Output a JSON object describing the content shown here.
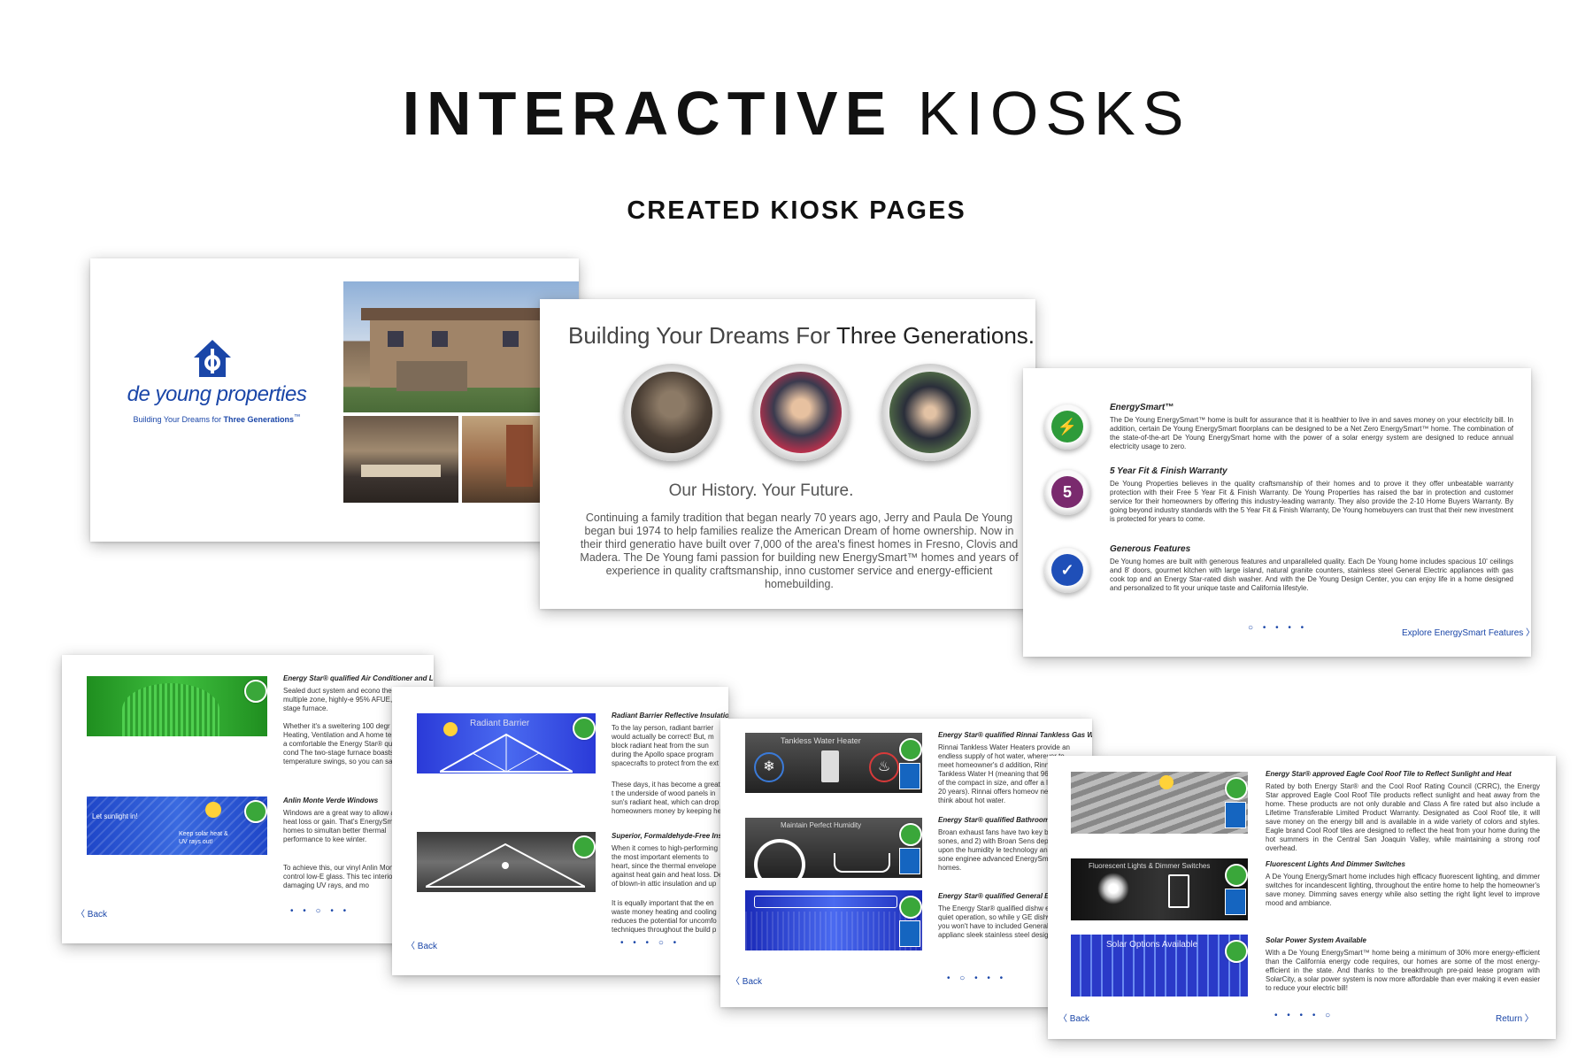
{
  "header": {
    "title_bold": "INTERACTIVE",
    "title_light": "KIOSKS",
    "subtitle": "CREATED KIOSK PAGES"
  },
  "card1": {
    "logo_text": "de young properties",
    "tagline_prefix": "Building Your Dreams for ",
    "tagline_bold": "Three Generations",
    "tagline_tm": "™"
  },
  "card2": {
    "headline_prefix": "Building Your Dreams For ",
    "headline_bold": "Three Generations.",
    "headline_tm": "™",
    "subhead": "Our History.  Your Future.",
    "body": "Continuing a family tradition that began nearly 70 years ago, Jerry and Paula De Young began bui 1974 to help families realize the American Dream of home ownership. Now in their third generatio have built over 7,000 of the area's finest homes in Fresno, Clovis and Madera. The De Young fami passion for building new EnergySmart™ homes and years of experience in quality craftsmanship, inno customer service and energy-efficient homebuilding."
  },
  "card3": {
    "features": [
      {
        "title": "EnergySmart™",
        "icon": "plug-icon",
        "color": "#2e9b3a",
        "body": "The De Young EnergySmart™ home is built for assurance that it is healthier to live in and saves money on your electricity bill. In addition, certain De Young EnergySmart floorplans can be designed to be a Net Zero EnergySmart™ home. The combination of the state-of-the-art De Young EnergySmart home with the power of a solar energy system are designed to reduce annual electricity usage to zero."
      },
      {
        "title": "5 Year Fit & Finish Warranty",
        "icon": "house-5-icon",
        "color": "#7a2a6e",
        "body": "De Young Properties believes in the quality craftsmanship of their homes and to prove it they offer unbeatable warranty protection with their Free 5 Year Fit & Finish Warranty. De Young Properties has raised the bar in protection and customer service for their homeowners by offering this industry-leading warranty. They also provide the 2-10 Home Buyers Warranty. By going beyond industry standards with the 5 Year Fit & Finish Warranty, De Young homebuyers can trust that their new investment is protected for years to come."
      },
      {
        "title": "Generous Features",
        "icon": "checklist-icon",
        "color": "#1f4fb8",
        "body": "De Young homes are built with generous features and unparalleled quality. Each De Young home includes spacious 10' ceilings and 8' doors, gourmet kitchen with large island, natural granite counters, stainless steel General Electric appliances with gas cook top and an Energy Star-rated dish washer. And with the De Young Design Center, you can enjoy life in a home designed and personalized to fit your unique taste and California lifestyle."
      }
    ],
    "dots": "○ • • • •",
    "explore": "Explore EnergySmart Features 〉"
  },
  "card4": {
    "h1": "Energy Star® qualified Air Conditioner and Lennox HVAC System",
    "p1a": "Sealed duct system and econo thermostat, multiple zone, highly-e 95% AFUE, two-stage furnace.",
    "p1b": "Whether it's a sweltering 100 degr Lennox Heating, Ventilation and A home tempered to a comfortable the Energy Star® qualified air cond The two-stage furnace boasts a temperature swings, so you can sav",
    "h2": "Anlin Monte Verde Windows",
    "p2a": "Windows are a great way to allow also allow heat loss or gain. That's EnergySmart™ homes to simultan better thermal performance to kee winter.",
    "p2b": "To achieve this, our vinyl Anlin Mon solar control low-E glass. This tec interior-damaging UV rays, and mo",
    "img2_left": "Let sunlight in!",
    "img2_right": "Keep solar heat & UV rays out!",
    "back": "〈 Back",
    "dots": "• • ○ • •"
  },
  "card5": {
    "h1": "Radiant Barrier Reflective Insulation System and Extra Roof Vents",
    "p1a": "To the lay person, radiant barrier would actually be correct! But, m block radiant heat from the sun during the Apollo space program spacecrafts to protect from the ext",
    "p1b": "These days, it has become a great t the underside of wood panels in sun's radiant heat, which can drop homeowners money by keeping he",
    "img1_label": "Radiant Barrier",
    "h2": "Superior, Formaldehyde-Free Insula",
    "p2a": "When it comes to high-performing the most important elements to heart, since the thermal envelope against heat gain and heat loss. De of blown-in attic insulation and up",
    "p2b": "It is equally important that the en waste money heating and cooling reduces the potential for uncomfo techniques throughout the build p",
    "back": "〈 Back",
    "dots": "• • • ○ •"
  },
  "card6": {
    "h1": "Energy Star® qualified Rinnai Tankless Gas Water Heater",
    "p1": "Rinnai Tankless Water Heaters provide an endless supply of hot water, wherever to meet homeowner's d addition, Rinnai Tankless Water H (meaning that 96 percent of the compact in size, and offer a longer to 20 years). Rinnai offers homeov new way to think about hot water.",
    "img1_label": "Tankless Water Heater",
    "h2": "Energy Star® qualified Bathroom Ex",
    "p2": "Broan exhaust fans have two key b 0.7 sones, and 2) with Broan Sens depending upon the humidity le technology and low-sone enginee advanced EnergySmart™ homes.",
    "img2_label": "Maintain Perfect Humidity",
    "h3": "Energy Star® qualified General Elec",
    "p3": "The Energy Star® qualified dishw efficient, quiet operation, so while y GE dishwashers, you won't have to included General Electric applianc sleek stainless steel design to pleas",
    "back": "〈 Back",
    "dots": "• ○ • • •"
  },
  "card7": {
    "h1": "Energy Star® approved Eagle Cool Roof Tile to Reflect Sunlight and Heat",
    "p1": "Rated by both Energy Star® and the Cool Roof Rating Council (CRRC), the Energy Star approved Eagle Cool Roof Tile products reflect sunlight and heat away from the home. These products are not only durable and Class A fire rated but also include a Lifetime Transferable Limited Product Warranty. Designated as Cool Roof tile, it will save money on the energy bill and is available in a wide variety of colors and styles. Eagle brand Cool Roof tiles are designed to reflect the heat from your home during the hot summers in the Central San Joaquin Valley, while maintaining a strong roof overhead.",
    "h2": "Fluorescent Lights And Dimmer Switches",
    "p2": "A De Young EnergySmart home includes high efficacy fluorescent lighting, and dimmer switches for incandescent lighting, throughout the entire home to help the homeowner's save money. Dimming saves energy while also setting the right light level to improve mood and ambiance.",
    "img2_label": "Fluorescent Lights & Dimmer Switches",
    "h3": "Solar Power System Available",
    "p3": "With a De Young EnergySmart™ home being a minimum of 30% more energy-efficient than the California energy code requires, our homes are some of the most energy-efficient in the state. And thanks to the breakthrough pre-paid lease program with SolarCity, a solar power system is now more affordable than ever making it even easier to reduce your electric bill!",
    "img3_label": "Solar Options Available",
    "back": "〈 Back",
    "dots": "• • • • ○",
    "return": "Return 〉"
  }
}
